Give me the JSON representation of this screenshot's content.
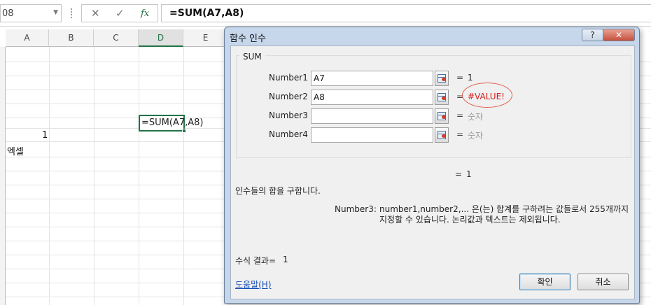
{
  "formula_bar": {
    "name_box": "08",
    "cancel_icon": "✕",
    "enter_icon": "✓",
    "fx_label": "fx",
    "formula": "=SUM(A7,A8)"
  },
  "grid": {
    "columns": [
      "A",
      "B",
      "C",
      "D",
      "E"
    ],
    "selected_column": "D",
    "cells": {
      "a_number": "1",
      "a_text": "엑셀",
      "d_formula": "=SUM(A7,A8)"
    }
  },
  "dialog": {
    "title": "함수 인수",
    "help_button": "?",
    "close_button": "✕",
    "function_name": "SUM",
    "args": [
      {
        "label": "Number1",
        "value": "A7",
        "result": "1"
      },
      {
        "label": "Number2",
        "value": "A8",
        "result": "#VALUE!"
      },
      {
        "label": "Number3",
        "value": "",
        "result": "숫자"
      },
      {
        "label": "Number4",
        "value": "",
        "result": "숫자"
      }
    ],
    "equals": "=",
    "total_result": "1",
    "description": "인수들의 합을 구합니다.",
    "arg_help_name": "Number3:",
    "arg_help_text": "number1,number2,... 은(는) 합계를 구하려는 값들로서 255개까지 지정할 수 있습니다. 논리값과 텍스트는 제외됩니다.",
    "formula_result_label": "수식 결과=",
    "formula_result_value": "1",
    "help_link": "도움말(H)",
    "ok_button": "확인",
    "cancel_button": "취소"
  },
  "colors": {
    "selection": "#217346",
    "error": "#d81b1b",
    "error_circle": "#e0604a",
    "dialog_frame": "#c6d7ec",
    "link": "#1a4fb8"
  }
}
